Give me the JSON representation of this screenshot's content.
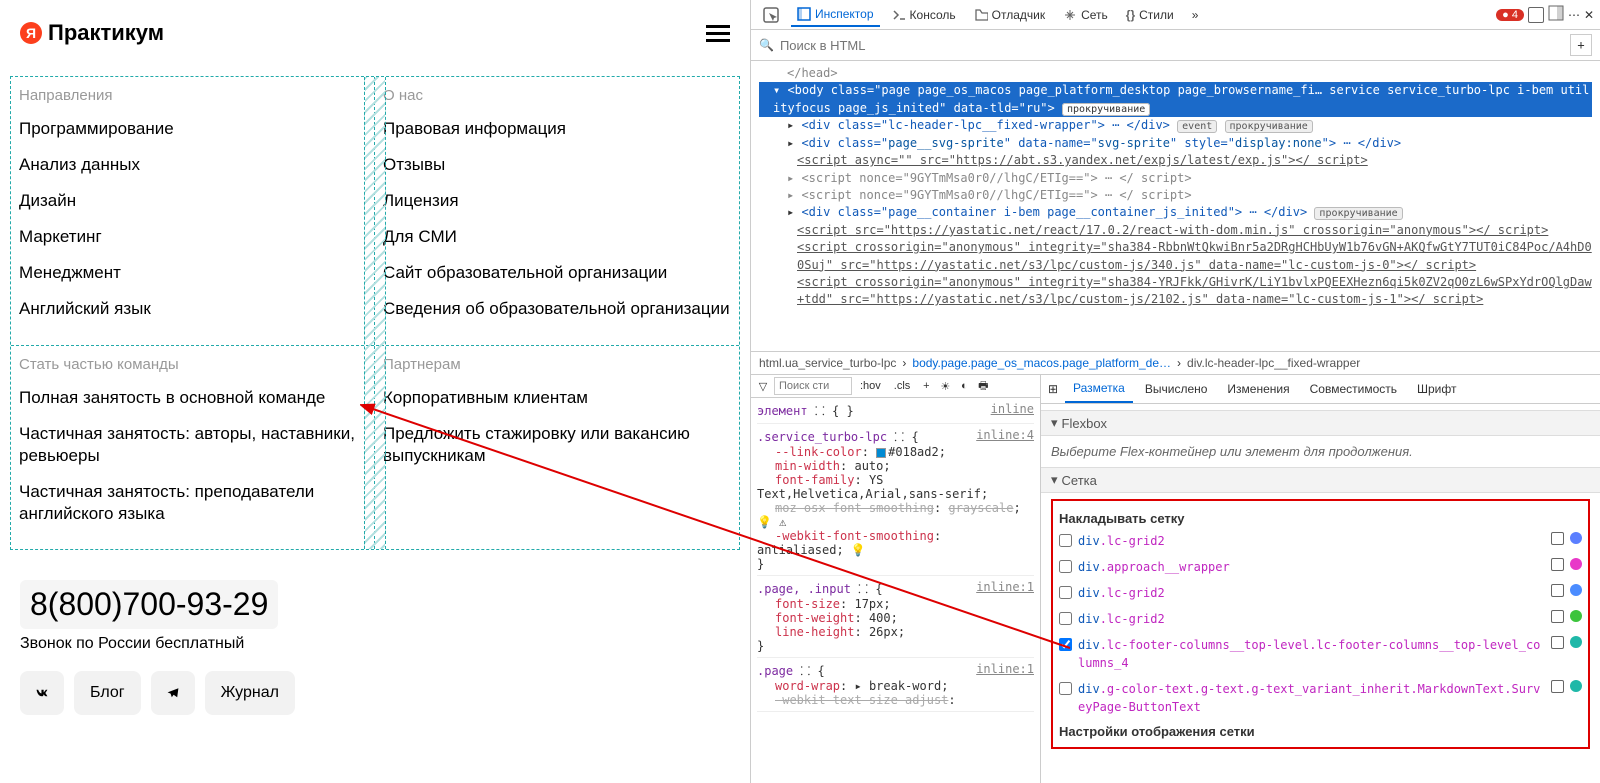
{
  "logo_text": "Практикум",
  "footer": {
    "col1_header": "Направления",
    "col1_items": [
      "Программирование",
      "Анализ данных",
      "Дизайн",
      "Маркетинг",
      "Менеджмент",
      "Английский язык"
    ],
    "col2_header": "О нас",
    "col2_items": [
      "Правовая информация",
      "Отзывы",
      "Лицензия",
      "Для СМИ",
      "Сайт образовательной организации",
      "Сведения об образовательной организации"
    ],
    "col3_header": "Стать частью команды",
    "col3_items": [
      "Полная занятость в основной команде",
      "Частичная занятость: авторы, наставники, ревьюеры",
      "Частичная занятость: преподаватели английского языка"
    ],
    "col4_header": "Партнерам",
    "col4_items": [
      "Корпоративным клиентам",
      "Предложить стажировку или вакансию выпускникам"
    ]
  },
  "phone": "8(800)700-93-29",
  "phone_sub": "Звонок по России бесплатный",
  "buttons": {
    "vk": "VK",
    "blog": "Блог",
    "tg": "✈",
    "journal": "Журнал"
  },
  "devtools": {
    "tabs": {
      "inspector": "Инспектор",
      "console": "Консоль",
      "debugger": "Отладчик",
      "network": "Сеть",
      "styles": "Стили"
    },
    "err_count": "4",
    "search_placeholder": "Поиск в HTML",
    "dom_head": "</head>",
    "dom_body_line": "<body class=\"page page_os_macos page_platform_desktop page_browsername_fi… service service_turbo-lpc i-bem utilityfocus page_js_inited\" data-tld=\"ru\">",
    "dom_body_pill": "прокручивание",
    "dom_l1": "<div class=\"lc-header-lpc__fixed-wrapper\"> ⋯ </div>",
    "dom_l1_pill1": "event",
    "dom_l1_pill2": "прокручивание",
    "dom_l2_a": "<div class=\"",
    "dom_l2_b": "page__svg-sprite",
    "dom_l2_c": "\" data-name=\"",
    "dom_l2_d": "svg-sprite",
    "dom_l2_e": "\" style=\"",
    "dom_l2_f": "display:none",
    "dom_l2_g": "\"> ⋯ </div>",
    "dom_l3": "<script async=\"\" src=\"https://abt.s3.yandex.net/expjs/latest/exp.js\"></ script>",
    "dom_l4": "<script nonce=\"9GYTmMsa0r0//lhgC/ETIg==\"> ⋯ </ script>",
    "dom_l5": "<script nonce=\"9GYTmMsa0r0//lhgC/ETIg==\"> ⋯ </ script>",
    "dom_l6": "<div class=\"page__container i-bem page__container_js_inited\"> ⋯ </div>",
    "dom_l6_pill": "прокручивание",
    "dom_l7": "<script src=\"https://yastatic.net/react/17.0.2/react-with-dom.min.js\" crossorigin=\"anonymous\"></ script>",
    "dom_l8": "<script crossorigin=\"anonymous\" integrity=\"sha384-RbbnWtQkwiBnr5a2DRgHCHbUyW1b76vGN+AKQfwGtY7TUT0iC84Poc/A4hD00Suj\" src=\"https://yastatic.net/s3/lpc/custom-js/340.js\" data-name=\"lc-custom-js-0\"></ script>",
    "dom_l9": "<script crossorigin=\"anonymous\" integrity=\"sha384-YRJFkk/GHivrK/LiY1bvlxPQEEXHezn6qi5k0ZV2qO0zL6wSPxYdrOQlgDaw+tdd\" src=\"https://yastatic.net/s3/lpc/custom-js/2102.js\" data-name=\"lc-custom-js-1\"></ script>",
    "breadcrumb": {
      "a": "html.ua_service_turbo-lpc",
      "b": "body.page.page_os_macos.page_platform_de…",
      "c": "div.lc-header-lpc__fixed-wrapper"
    },
    "styles_search": "Поиск сти",
    "hov": ":hov",
    "cls": ".cls",
    "rule0_sel": "элемент",
    "rule0_brace": "{",
    "rule0_inline": "inline",
    "rule1_sel": ".service_turbo-lpc",
    "rule1_inline": "inline:4",
    "rule1_p1": "--link-color",
    "rule1_v1": "#018ad2",
    "rule1_p2": "min-width",
    "rule1_v2": "auto",
    "rule1_p3": "font-family",
    "rule1_v3": "YS Text,Helvetica,Arial,sans-serif",
    "rule1_p4": "moz-osx-font-smoothing",
    "rule1_v4": "grayscale",
    "rule1_p5": "-webkit-font-smoothing",
    "rule1_v5": "antialiased",
    "rule2_sel": ".page, .input",
    "rule2_inline": "inline:1",
    "rule2_p1": "font-size",
    "rule2_v1": "17px",
    "rule2_p2": "font-weight",
    "rule2_v2": "400",
    "rule2_p3": "line-height",
    "rule2_v3": "26px",
    "rule3_sel": ".page",
    "rule3_inline": "inline:1",
    "rule3_p1": "word-wrap",
    "rule3_v1": "break-word",
    "rule3_p2": "-webkit-text-size-adjust",
    "layout_tabs": {
      "a": "Разметка",
      "b": "Вычислено",
      "c": "Изменения",
      "d": "Совместимость",
      "e": "Шрифт"
    },
    "flexbox_head": "Flexbox",
    "flexbox_hint": "Выберите Flex-контейнер или элемент для продолжения.",
    "grid_head": "Сетка",
    "grid_overlay": "Накладывать сетку",
    "grid1_el": "div",
    "grid1_cls": ".lc-grid2",
    "grid1_color": "#5b7fff",
    "grid2_el": "div",
    "grid2_cls": ".approach__wrapper",
    "grid2_color": "#e838c8",
    "grid3_el": "div",
    "grid3_cls": ".lc-grid2",
    "grid3_color": "#4b8cff",
    "grid4_el": "div",
    "grid4_cls": ".lc-grid2",
    "grid4_color": "#3cc43c",
    "grid5_el": "div",
    "grid5_cls": ".lc-footer-columns__top-level.lc-footer-columns__top-level_columns_4",
    "grid5_color": "#1fb8a8",
    "grid6_el": "div",
    "grid6_cls": ".g-color-text.g-text.g-text_variant_inherit.MarkdownText.SurveyPage-ButtonText",
    "grid6_color": "#1fb8a8",
    "grid_settings": "Настройки отображения сетки"
  }
}
